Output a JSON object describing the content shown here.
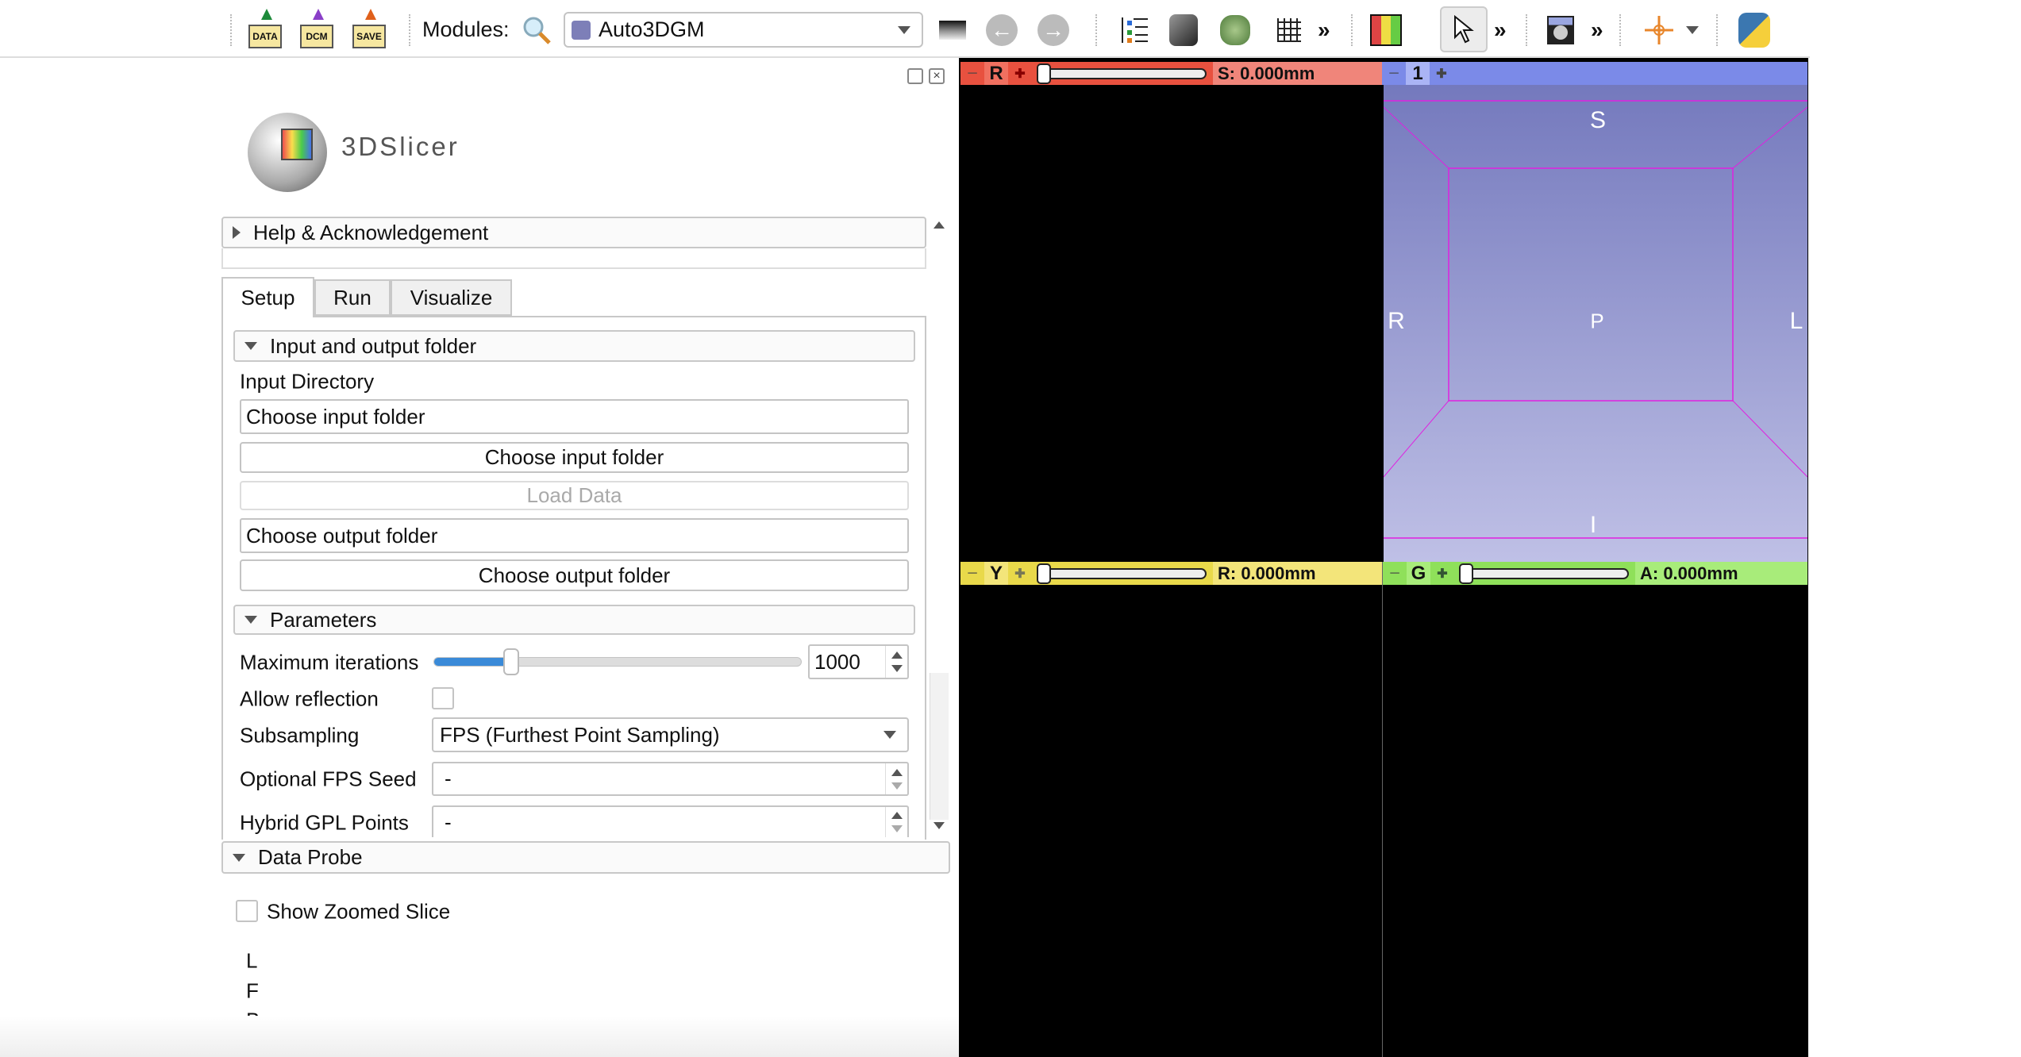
{
  "toolbar": {
    "data_label": "DATA",
    "dcm_label": "DCM",
    "save_label": "SAVE",
    "modules_label": "Modules:",
    "module_selected": "Auto3DGM",
    "more_glyph": "»"
  },
  "logo": {
    "text": "3DSlicer"
  },
  "help_section": {
    "label": "Help & Acknowledgement"
  },
  "tabs": [
    {
      "label": "Setup",
      "active": true
    },
    {
      "label": "Run"
    },
    {
      "label": "Visualize"
    }
  ],
  "io_section": {
    "header": "Input and output folder",
    "input_dir_label": "Input Directory",
    "input_field_value": "Choose input folder",
    "choose_input_button": "Choose input folder",
    "load_data_button": "Load Data",
    "output_field_value": "Choose output folder",
    "choose_output_button": "Choose output folder"
  },
  "parameters": {
    "header": "Parameters",
    "max_iter_label": "Maximum iterations",
    "max_iter_value": "1000",
    "max_iter_slider_fraction": 0.21,
    "allow_reflection_label": "Allow reflection",
    "allow_reflection_checked": false,
    "subsampling_label": "Subsampling",
    "subsampling_value": "FPS (Furthest Point Sampling)",
    "fps_seed_label": "Optional FPS Seed",
    "fps_seed_value": "-",
    "hybrid_label": "Hybrid GPL Points",
    "hybrid_value": "-"
  },
  "data_probe": {
    "header": "Data Probe",
    "show_zoomed_label": "Show Zoomed Slice",
    "show_zoomed_checked": false,
    "lines": [
      "L",
      "F",
      "B"
    ]
  },
  "views": {
    "red": {
      "letter": "R",
      "offset": "S: 0.000mm",
      "color": "#e8513f"
    },
    "threed": {
      "number": "1",
      "color": "#7b8ae8"
    },
    "yellow": {
      "letter": "Y",
      "offset": "R: 0.000mm",
      "color": "#e9d94a"
    },
    "green": {
      "letter": "G",
      "offset": "A: 0.000mm",
      "color": "#8fe05a"
    },
    "orientation": {
      "top": "S",
      "bottom": "I",
      "left": "R",
      "right": "L",
      "center": "P"
    }
  }
}
